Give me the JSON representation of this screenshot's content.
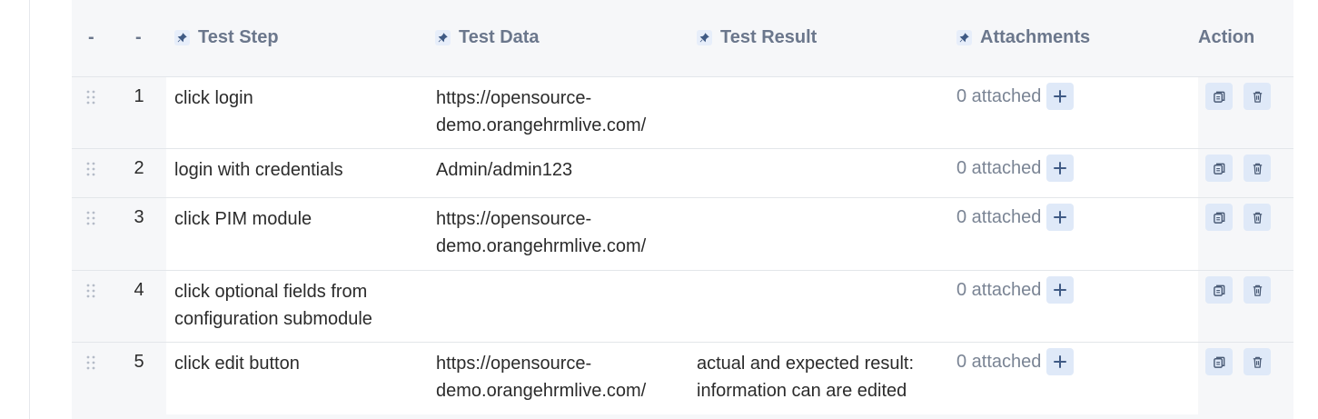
{
  "header": {
    "drag_col": "-",
    "num_col": "-",
    "step": "Test Step",
    "data": "Test Data",
    "result": "Test Result",
    "attachments": "Attachments",
    "action": "Action"
  },
  "rows": [
    {
      "num": "1",
      "step_lines": [
        "click login"
      ],
      "data_lines": [
        "https://opensource-",
        "demo.orangehrmlive.com/"
      ],
      "result_lines": [],
      "attached": "0 attached"
    },
    {
      "num": "2",
      "step_lines": [
        "login with credentials"
      ],
      "data_lines": [
        "Admin/admin123"
      ],
      "result_lines": [],
      "attached": "0 attached"
    },
    {
      "num": "3",
      "step_lines": [
        "click PIM module"
      ],
      "data_lines": [
        "https://opensource-",
        "demo.orangehrmlive.com/"
      ],
      "result_lines": [],
      "attached": "0 attached"
    },
    {
      "num": "4",
      "step_lines": [
        "click optional fields from",
        "configuration submodule"
      ],
      "data_lines": [],
      "result_lines": [],
      "attached": "0 attached"
    },
    {
      "num": "5",
      "step_lines": [
        "click edit button"
      ],
      "data_lines": [
        "https://opensource-",
        "demo.orangehrmlive.com/"
      ],
      "result_lines": [
        "actual and expected result:",
        "information can are edited"
      ],
      "attached": "0 attached"
    }
  ],
  "icons": {
    "pin": "pin-icon",
    "drag": "drag-handle-icon",
    "add": "plus-icon",
    "clone": "clone-icon",
    "delete": "trash-icon"
  },
  "colors": {
    "header_text": "#6b778c",
    "icon_button_bg": "#dfe9f8",
    "icon_color": "#4a5b76"
  }
}
